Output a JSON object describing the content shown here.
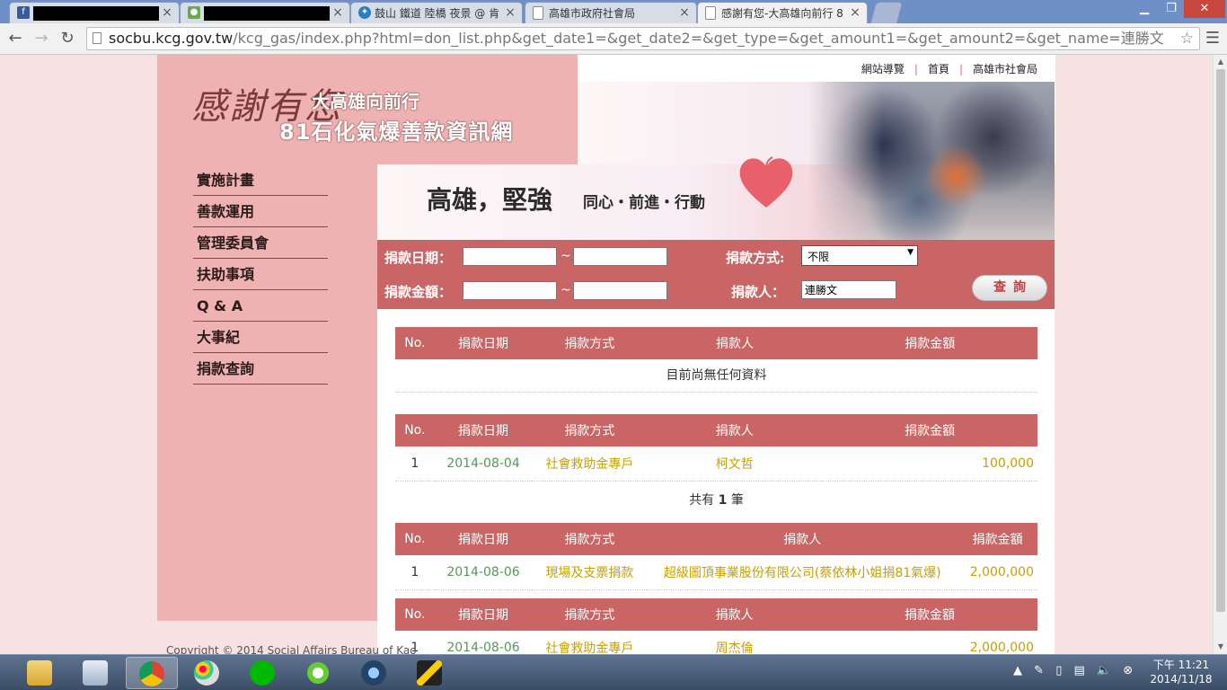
{
  "browser": {
    "tabs": [
      {
        "title": "",
        "redacted": true,
        "favicon": "facebook-icon"
      },
      {
        "title": "",
        "redacted": true,
        "favicon": "maps-icon"
      },
      {
        "title": "鼓山 鐵道 陸橋 夜景 @ 肯",
        "favicon": "blog-icon"
      },
      {
        "title": "高雄市政府社會局",
        "favicon": "page-icon"
      },
      {
        "title": "感謝有您-大高雄向前行 8",
        "favicon": "page-icon",
        "active": true
      }
    ],
    "url_host": "socbu.kcg.gov.tw",
    "url_path": "/kcg_gas/index.php?html=don_list.php&get_date1=&get_date2=&get_type=&get_amount1=&get_amount2=&get_name=連勝文"
  },
  "site": {
    "logo_text": "感謝有您",
    "tagline": "大高雄向前行",
    "title": "81石化氣爆善款資訊網",
    "slogan": "高雄，堅強",
    "slogan_sub": "同心・前進・行動",
    "toplinks": [
      "網站導覽",
      "首頁",
      "高雄市社會局"
    ],
    "nav": [
      "實施計畫",
      "善款運用",
      "管理委員會",
      "扶助事項",
      "Q & A",
      "大事紀",
      "捐款查詢"
    ],
    "copyright": "Copyright © 2014 Social Affairs Bureau of Kao"
  },
  "search": {
    "date_label": "捐款日期：",
    "amount_label": "捐款金額：",
    "type_label": "捐款方式:",
    "name_label": "捐款人：",
    "tilde": "~",
    "date_from": "",
    "date_to": "",
    "amount_from": "",
    "amount_to": "",
    "type_selected": "不限",
    "name_value": "連勝文",
    "button_label": "查詢"
  },
  "columns": [
    "No.",
    "捐款日期",
    "捐款方式",
    "捐款人",
    "捐款金額"
  ],
  "results": {
    "empty_message": "目前尚無任何資料",
    "table2": {
      "no": "1",
      "date": "2014-08-04",
      "type": "社會救助金專戶",
      "name": "柯文哲",
      "amount": "100,000"
    },
    "summary_prefix": "共有 ",
    "summary_count": "1",
    "summary_suffix": " 筆",
    "table3": {
      "no": "1",
      "date": "2014-08-06",
      "type": "現場及支票捐款",
      "name": "超級圖頂事業股份有限公司(蔡依林小姐捐81氣爆)",
      "amount": "2,000,000"
    },
    "table4": {
      "no": "1",
      "date": "2014-08-06",
      "type": "社會救助金專戶",
      "name": "周杰倫",
      "amount": "2,000,000"
    }
  },
  "taskbar": {
    "clock_time": "下午 11:21",
    "clock_date": "2014/11/18"
  },
  "colors": {
    "accent": "#c96565",
    "sidebar": "#efb2b2",
    "date_text": "#559955",
    "value_text": "#c8a000"
  }
}
